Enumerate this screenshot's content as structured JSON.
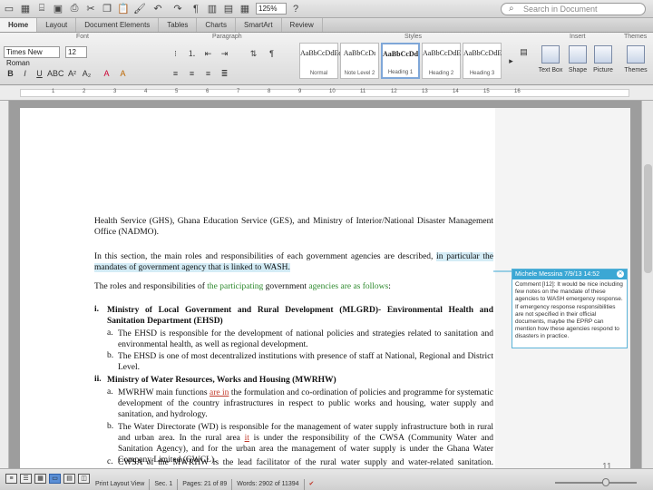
{
  "toolbar": {
    "zoom": "125%",
    "search_placeholder": "Search in Document",
    "icons": [
      "new-icon",
      "templates-icon",
      "open-icon",
      "save-icon",
      "print-icon",
      "cut-icon",
      "copy-icon",
      "paste-icon",
      "format-painter-icon",
      "undo-icon",
      "redo-icon",
      "show-formatting-icon",
      "sidebar-icon",
      "toolbox-icon",
      "zoom-icon",
      "help-icon"
    ]
  },
  "tabs": [
    "Home",
    "Layout",
    "Document Elements",
    "Tables",
    "Charts",
    "SmartArt",
    "Review"
  ],
  "ribbon": {
    "groups": [
      "Font",
      "Paragraph",
      "Styles",
      "Insert",
      "Themes"
    ],
    "font_name": "Times New Roman",
    "font_size": "12",
    "styles": [
      {
        "sample": "AaBbCcDdEe",
        "name": "Normal"
      },
      {
        "sample": "AaBbCcDı",
        "name": "Note Level 2"
      },
      {
        "sample": "AaBbCcDd",
        "name": "Heading 1"
      },
      {
        "sample": "AaBbCcDdE",
        "name": "Heading 2"
      },
      {
        "sample": "AaBbCcDdE",
        "name": "Heading 3"
      }
    ],
    "insert": [
      "Text Box",
      "Shape",
      "Picture"
    ],
    "themes": "Themes"
  },
  "ruler": [
    "1",
    "2",
    "3",
    "4",
    "5",
    "6",
    "7",
    "8",
    "9",
    "10",
    "11",
    "12",
    "13",
    "14",
    "15",
    "16"
  ],
  "document": {
    "p1": "Health Service (GHS), Ghana Education Service (GES), and Ministry of Interior/National Disaster Management Office (NADMO).",
    "p2a": "In this section, the main roles and responsibilities of each government agencies are described,",
    "p2b": "in particular the mandates of government agency that is linked to WASH.",
    "p3a": "The roles and responsibilities of",
    "p3b": "the participating",
    "p3c": "government",
    "p3d": "agencies are as follows",
    "p3e": ":",
    "i_marker": "i.",
    "i_head": "Ministry of Local Government and Rural Development (MLGRD)- Environmental Health and Sanitation Department (EHSD)",
    "a1_marker": "a.",
    "a1": "The EHSD is responsible for the development of national policies and strategies related to sanitation and environmental health, as well as regional development.",
    "b1_marker": "b.",
    "b1": "The EHSD is one of most decentralized institutions with presence of staff at National, Regional and District Level.",
    "ii_marker": "ii.",
    "ii_head": "Ministry of Water Resources, Works and Housing (MWRHW)",
    "a2_marker": "a.",
    "a2a": "MWRHW main functions",
    "a2b": "are in",
    "a2c": "the formulation and co-ordination of policies and programme for systematic development of the country infrastructures in respect to public works and housing, water supply and sanitation, and hydrology.",
    "b2_marker": "b.",
    "b2a": "The Water Directorate (WD) is responsible for the management of water supply infrastructure both in rural and urban area. In the rural area",
    "b2b": "it",
    "b2c": "is under the responsibility of the CWSA (Community Water and Sanitation Agency), and for the urban area the management of water supply is under the Ghana Water Company Limited (GWCL).",
    "c2_marker": "c.",
    "c2": "CWSA of the MWRHW is the lead facilitator of the rural water supply and water-related sanitation. CWSA's"
  },
  "comment": {
    "header": "Michele Messina 7/9/13 14:52",
    "body": "Comment [I12]: It would be nice including few notes on the mandate of these agencies to WASH emergency response. If emergency response responsibilities are not specified in their official documents, maybe the EPRP can mention how these agencies respond to disasters in practice."
  },
  "page_number": "11",
  "status": {
    "view": "Print Layout View",
    "sec_label": "Sec.",
    "sec": "1",
    "pages_label": "Pages:",
    "pages": "21 of 89",
    "words_label": "Words:",
    "words": "2902 of 11394"
  },
  "colors": {
    "accent": "#3ba7d4",
    "highlight": "#d4ecf6",
    "tracked_green": "#2e8a2e",
    "tracked_red": "#c03a2b"
  }
}
